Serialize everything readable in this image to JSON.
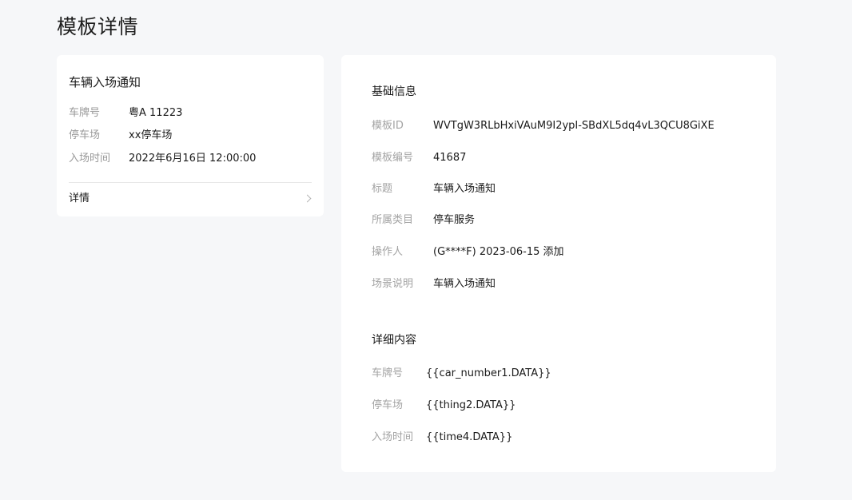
{
  "page": {
    "title": "模板详情"
  },
  "preview": {
    "title": "车辆入场通知",
    "fields": [
      {
        "label": "车牌号",
        "value": "粤A 11223"
      },
      {
        "label": "停车场",
        "value": "xx停车场"
      },
      {
        "label": "入场时间",
        "value": "2022年6月16日 12:00:00"
      }
    ],
    "detail_link": "详情",
    "detail_icon": "chevron-right-icon"
  },
  "basic_info": {
    "heading": "基础信息",
    "fields": [
      {
        "label": "模板ID",
        "value": "WVTgW3RLbHxiVAuM9I2ypI-SBdXL5dq4vL3QCU8GiXE"
      },
      {
        "label": "模板编号",
        "value": "41687"
      },
      {
        "label": "标题",
        "value": "车辆入场通知"
      },
      {
        "label": "所属类目",
        "value": "停车服务"
      },
      {
        "label": "操作人",
        "value": "(G****F) 2023-06-15 添加"
      },
      {
        "label": "场景说明",
        "value": "车辆入场通知"
      }
    ]
  },
  "detail_content": {
    "heading": "详细内容",
    "fields": [
      {
        "label": "车牌号",
        "value": "{{car_number1.DATA}}"
      },
      {
        "label": "停车场",
        "value": "{{thing2.DATA}}"
      },
      {
        "label": "入场时间",
        "value": "{{time4.DATA}}"
      }
    ]
  }
}
